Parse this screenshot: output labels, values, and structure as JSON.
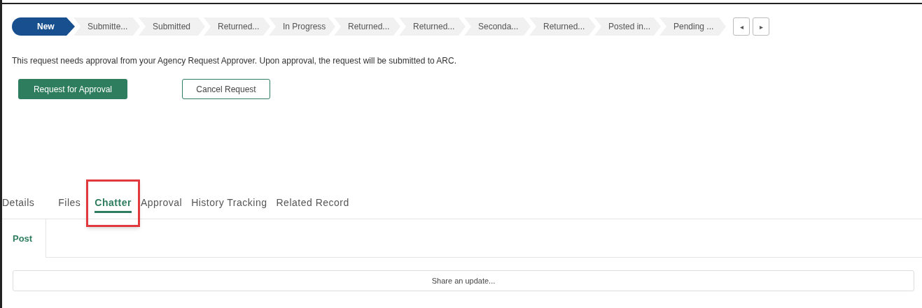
{
  "path": {
    "steps": [
      {
        "label": "New",
        "selected": true
      },
      {
        "label": "Submitte...",
        "selected": false
      },
      {
        "label": "Submitted",
        "selected": false
      },
      {
        "label": "Returned...",
        "selected": false
      },
      {
        "label": "In Progress",
        "selected": false
      },
      {
        "label": "Returned...",
        "selected": false
      },
      {
        "label": "Returned...",
        "selected": false
      },
      {
        "label": "Seconda...",
        "selected": false
      },
      {
        "label": "Returned...",
        "selected": false
      },
      {
        "label": "Posted in...",
        "selected": false
      },
      {
        "label": "Pending ...",
        "selected": false
      }
    ],
    "nav_buttons": [
      {
        "label": "◂"
      },
      {
        "label": "▸"
      }
    ]
  },
  "message": "This request needs approval from your Agency Request Approver. Upon approval, the request will be submitted to ARC.",
  "actions": [
    {
      "label": "Request for Approval",
      "kind": "primary"
    },
    {
      "label": "Cancel Request",
      "kind": "outline"
    }
  ],
  "tabs": [
    {
      "label": "Details",
      "selected": false,
      "highlighted": false
    },
    {
      "label": "Files",
      "selected": false,
      "highlighted": false
    },
    {
      "label": "Chatter",
      "selected": true,
      "highlighted": true
    },
    {
      "label": "Approval",
      "selected": false,
      "highlighted": false
    },
    {
      "label": "History Tracking",
      "selected": false,
      "highlighted": false
    },
    {
      "label": "Related Record",
      "selected": false,
      "highlighted": false
    }
  ],
  "publisher": {
    "tab": "Post",
    "placeholder": "Share an update..."
  }
}
